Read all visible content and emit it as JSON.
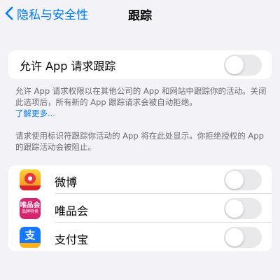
{
  "nav": {
    "back_label": "隐私与安全性",
    "title": "跟踪"
  },
  "allow_tracking": {
    "label": "允许 App 请求跟踪",
    "enabled": false,
    "footer": "允许 App 请求权限以在其他公司的 App 和网站中跟踪你的活动。关闭此选项后，所有新的 App 跟踪请求会被自动拒绝。",
    "learn_more": "了解更多..."
  },
  "apps_header": "请求使用标识符跟踪你活动的 App 将在此处显示。你拒绝授权的 App 的跟踪活动会被阻止。",
  "apps": [
    {
      "name": "微博",
      "icon": "weibo-icon",
      "enabled": false
    },
    {
      "name": "唯品会",
      "icon": "vipshop-icon",
      "icon_text": "唯品会",
      "icon_subtext": "品牌特卖",
      "enabled": false
    },
    {
      "name": "支付宝",
      "icon": "alipay-icon",
      "icon_text": "支",
      "enabled": false
    }
  ],
  "colors": {
    "accent": "#007aff",
    "background": "#f2f2f7",
    "toggle_off": "#e9e9eb"
  }
}
